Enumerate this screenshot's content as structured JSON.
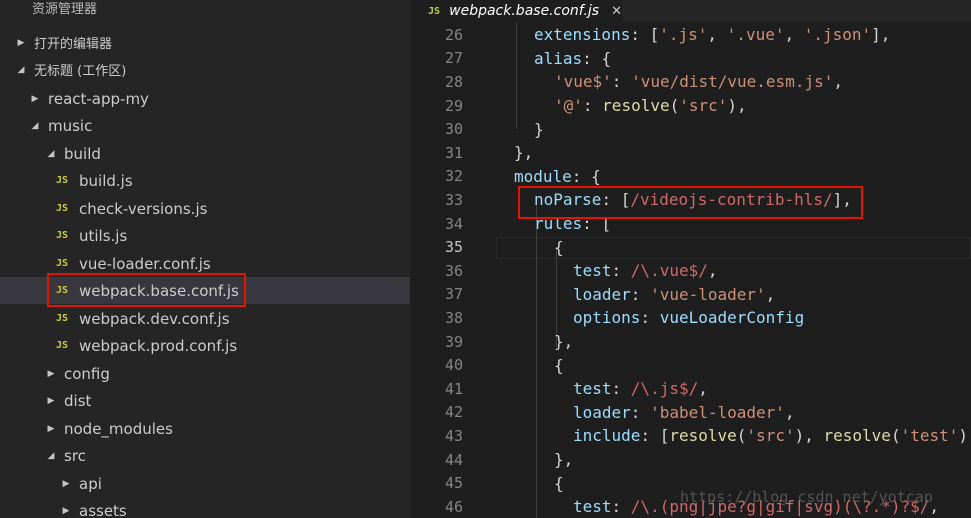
{
  "sidebar": {
    "title": "资源管理器",
    "section_open_editors": "打开的编辑器",
    "section_workspace": "无标题 (工作区)",
    "tree": [
      {
        "label": "react-app-my",
        "type": "folder",
        "state": "collapsed",
        "depth": 1
      },
      {
        "label": "music",
        "type": "folder",
        "state": "expanded",
        "depth": 1
      },
      {
        "label": "build",
        "type": "folder",
        "state": "expanded",
        "depth": 2
      },
      {
        "label": "build.js",
        "type": "file",
        "depth": 3
      },
      {
        "label": "check-versions.js",
        "type": "file",
        "depth": 3
      },
      {
        "label": "utils.js",
        "type": "file",
        "depth": 3
      },
      {
        "label": "vue-loader.conf.js",
        "type": "file",
        "depth": 3
      },
      {
        "label": "webpack.base.conf.js",
        "type": "file",
        "depth": 3,
        "selected": true
      },
      {
        "label": "webpack.dev.conf.js",
        "type": "file",
        "depth": 3
      },
      {
        "label": "webpack.prod.conf.js",
        "type": "file",
        "depth": 3
      },
      {
        "label": "config",
        "type": "folder",
        "state": "collapsed",
        "depth": 2
      },
      {
        "label": "dist",
        "type": "folder",
        "state": "collapsed",
        "depth": 2
      },
      {
        "label": "node_modules",
        "type": "folder",
        "state": "collapsed",
        "depth": 2
      },
      {
        "label": "src",
        "type": "folder",
        "state": "expanded",
        "depth": 2
      },
      {
        "label": "api",
        "type": "folder",
        "state": "collapsed",
        "depth": 3
      },
      {
        "label": "assets",
        "type": "folder",
        "state": "collapsed",
        "depth": 3
      }
    ],
    "js_badge": "JS"
  },
  "tab": {
    "icon": "JS",
    "label": "webpack.base.conf.js",
    "close": "✕"
  },
  "editor": {
    "active_line": "35",
    "lines": [
      {
        "n": "26",
        "t": "extensions: ['.js', '.vue', '.json'],"
      },
      {
        "n": "27",
        "t": "alias: {"
      },
      {
        "n": "28",
        "t": "'vue$': 'vue/dist/vue.esm.js',"
      },
      {
        "n": "29",
        "t": "'@': resolve('src'),"
      },
      {
        "n": "30",
        "t": "}"
      },
      {
        "n": "31",
        "t": "},"
      },
      {
        "n": "32",
        "t": "module: {"
      },
      {
        "n": "33",
        "t": "noParse: [/videojs-contrib-hls/],"
      },
      {
        "n": "34",
        "t": "rules: ["
      },
      {
        "n": "35",
        "t": "{"
      },
      {
        "n": "36",
        "t": "test: /\\.vue$/,"
      },
      {
        "n": "37",
        "t": "loader: 'vue-loader',"
      },
      {
        "n": "38",
        "t": "options: vueLoaderConfig"
      },
      {
        "n": "39",
        "t": "},"
      },
      {
        "n": "40",
        "t": "{"
      },
      {
        "n": "41",
        "t": "test: /\\.js$/,"
      },
      {
        "n": "42",
        "t": "loader: 'babel-loader',"
      },
      {
        "n": "43",
        "t": "include: [resolve('src'), resolve('test'),"
      },
      {
        "n": "44",
        "t": "},"
      },
      {
        "n": "45",
        "t": "{"
      },
      {
        "n": "46",
        "t": "test: /\\.(png|jpe?g|gif|svg)(\\?.*)?$/,"
      }
    ]
  },
  "watermark": "https://blog.csdn.net/yotcap",
  "colors": {
    "highlight_box": "#e51400",
    "js_icon": "#cbcb41",
    "editor_bg": "#1e1e1e",
    "sidebar_bg": "#252526"
  }
}
